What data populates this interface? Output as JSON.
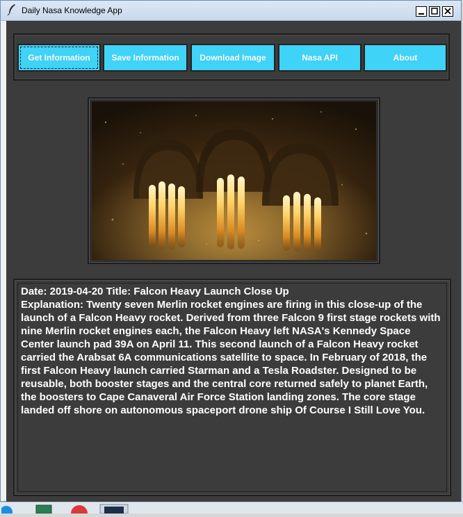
{
  "window": {
    "title": "Daily Nasa Knowledge App"
  },
  "toolbar": {
    "buttons": [
      {
        "label": "Get Information"
      },
      {
        "label": "Save Information"
      },
      {
        "label": "Download Image"
      },
      {
        "label": "Nasa API"
      },
      {
        "label": "About"
      }
    ]
  },
  "content": {
    "text": "Date: 2019-04-20 Title: Falcon Heavy Launch Close Up\nExplanation: Twenty seven Merlin rocket engines are firing in this close-up of the launch of a Falcon Heavy rocket. Derived from three Falcon 9 first stage rockets with nine Merlin rocket engines each, the Falcon Heavy left NASA's Kennedy Space Center launch pad 39A on April 11. This second launch of a Falcon Heavy rocket carried the Arabsat 6A communications satellite to space. In February of 2018, the first Falcon Heavy launch carried Starman and a Tesla Roadster. Designed to be reusable, both booster stages and the central core returned safely to planet Earth, the boosters to Cape Canaveral Air Force Station landing zones. The core stage landed off shore on autonomous spaceport drone ship Of Course I Still Love You."
  },
  "colors": {
    "button_bg": "#3fd3f7",
    "panel_bg": "#3c3c3c",
    "text": "#ffffff"
  },
  "icons": {
    "title": "feather-icon",
    "minimize": "minimize-icon",
    "maximize": "maximize-icon",
    "close": "close-icon"
  }
}
